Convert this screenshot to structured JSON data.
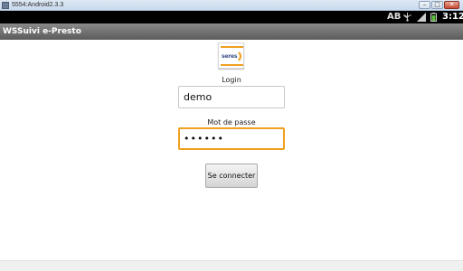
{
  "window": {
    "title": "5554:Android2.3.3",
    "controls": {
      "minimize": "–",
      "maximize": "□",
      "close": "✕"
    }
  },
  "statusbar": {
    "ab_label": "AB",
    "time": "3:12",
    "icons": [
      "usb-icon",
      "signal-icon",
      "battery-icon"
    ]
  },
  "app": {
    "title": "WSSuivi e-Presto"
  },
  "logo": {
    "text": "seres",
    "accent_color": "#f0a020"
  },
  "form": {
    "login_label": "Login",
    "login_value": "demo",
    "password_label": "Mot de passe",
    "password_value": "••••••",
    "submit_label": "Se connecter"
  },
  "colors": {
    "focus_border": "#f0a020",
    "appbar": "#6e6e6e",
    "statusbar": "#000000"
  }
}
